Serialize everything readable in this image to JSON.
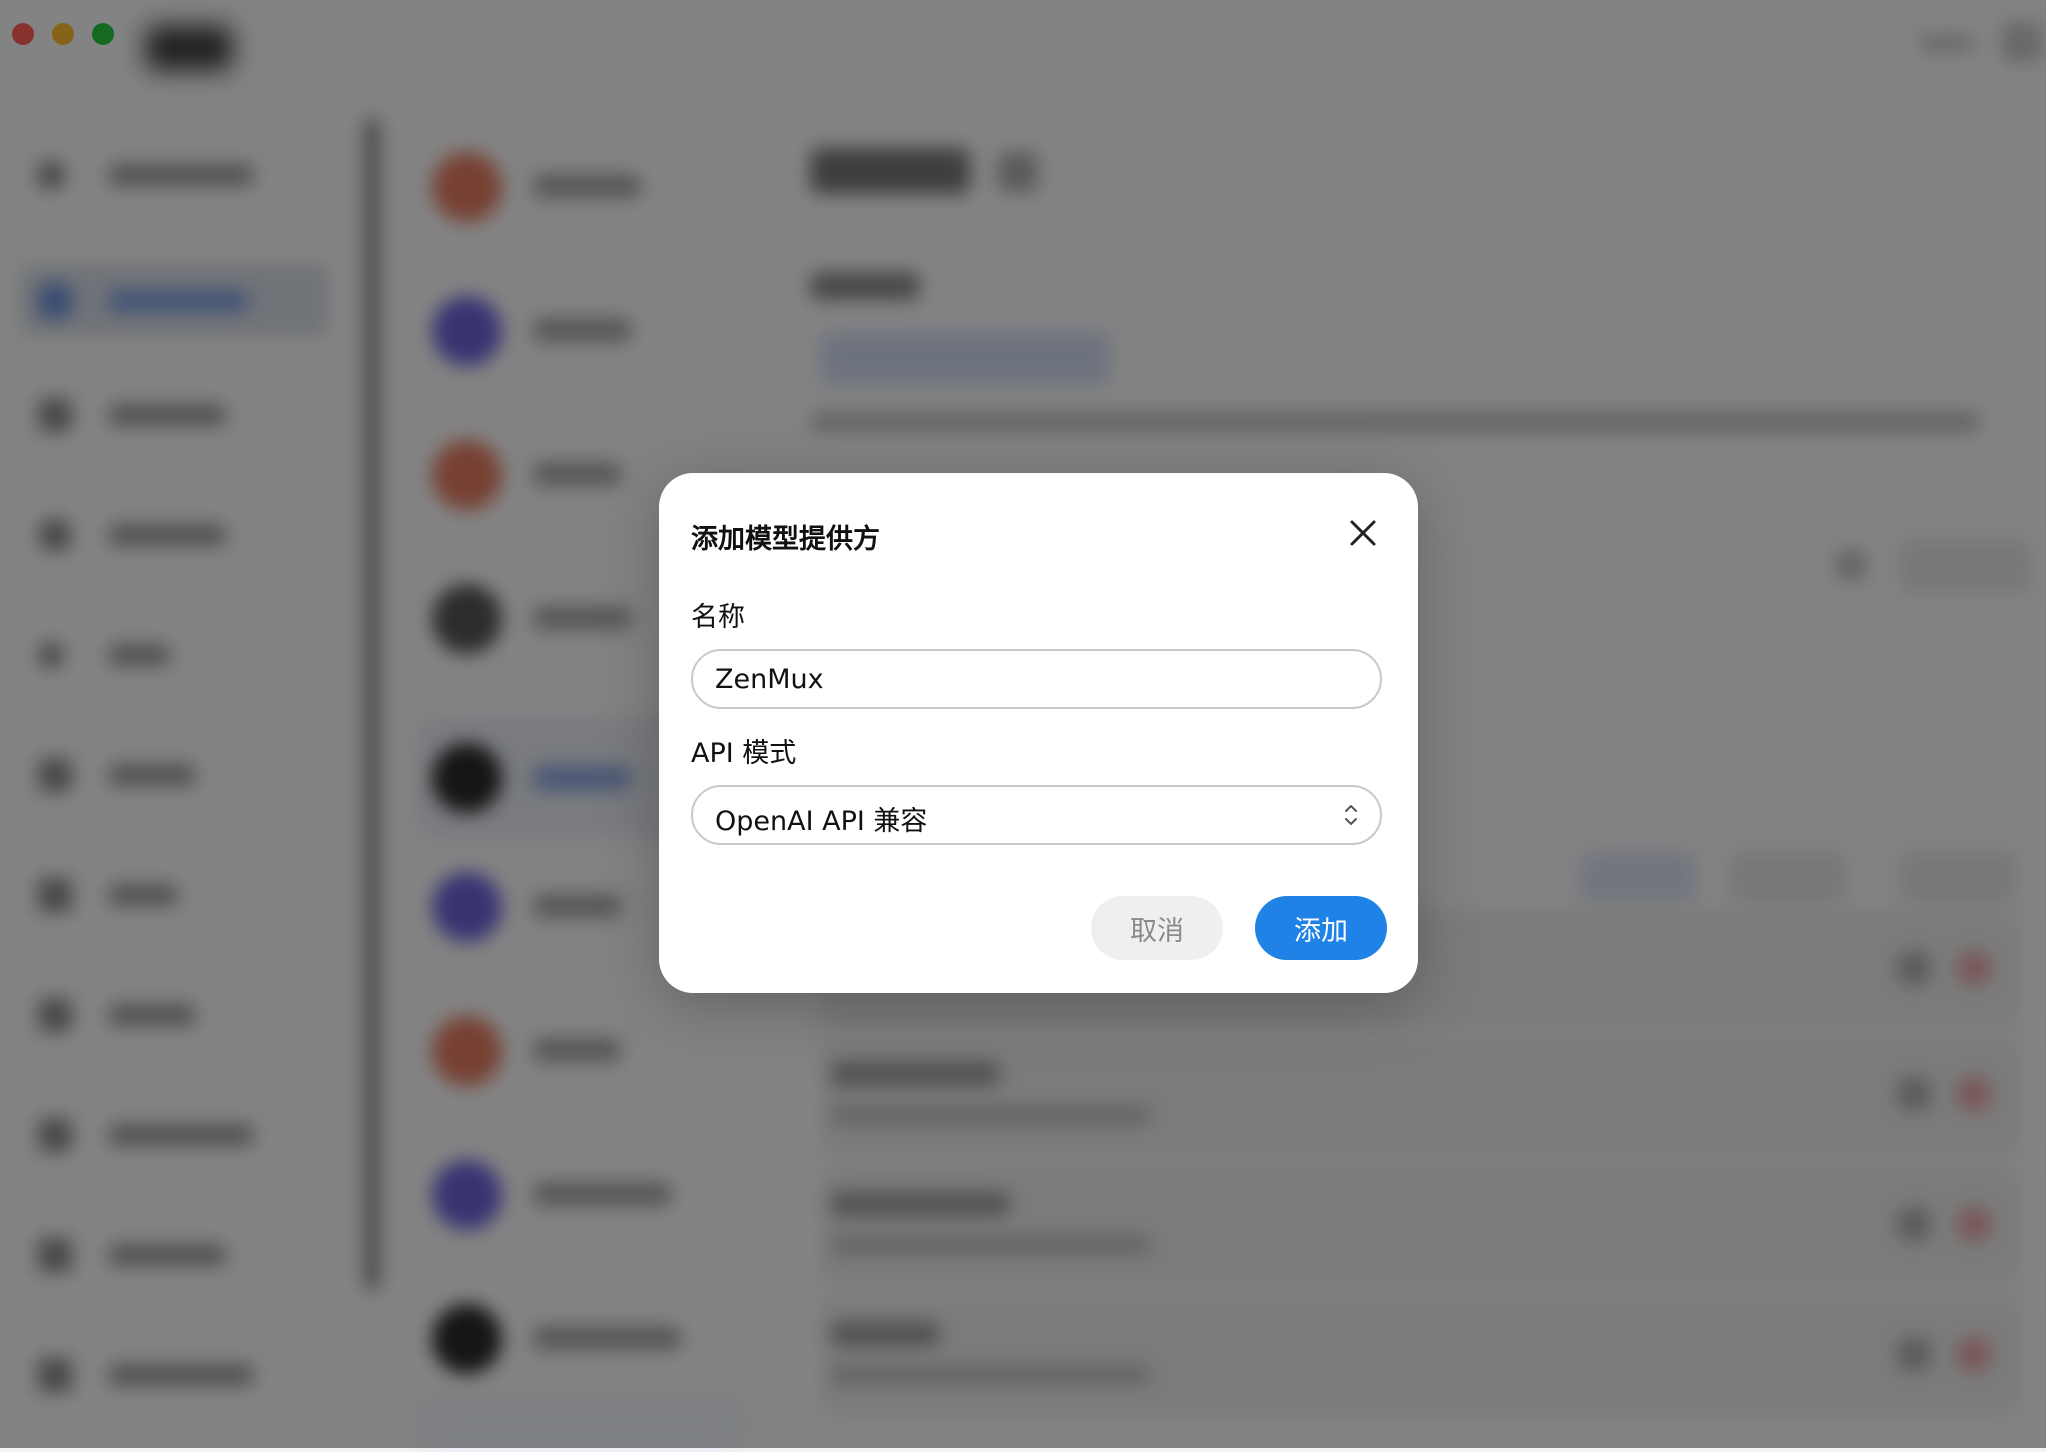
{
  "window": {
    "traffic_lights": [
      "#ff5f57",
      "#febc2e",
      "#28c840"
    ]
  },
  "provider_avatars": [
    "#e07a5f",
    "#6b63d8",
    "#e07a5f",
    "#555555",
    "#2a2a2a",
    "#6b63d8",
    "#e07a5f",
    "#6b63d8",
    "#2a2a2a"
  ],
  "dialog": {
    "title": "添加模型提供方",
    "name_label": "名称",
    "name_value": "ZenMux",
    "api_mode_label": "API 模式",
    "api_mode_value": "OpenAI API 兼容",
    "cancel_label": "取消",
    "add_label": "添加"
  },
  "colors": {
    "overlay": "rgba(0,0,0,0.47)",
    "primary": "#1f82e6",
    "dialog_bg": "#ffffff"
  }
}
